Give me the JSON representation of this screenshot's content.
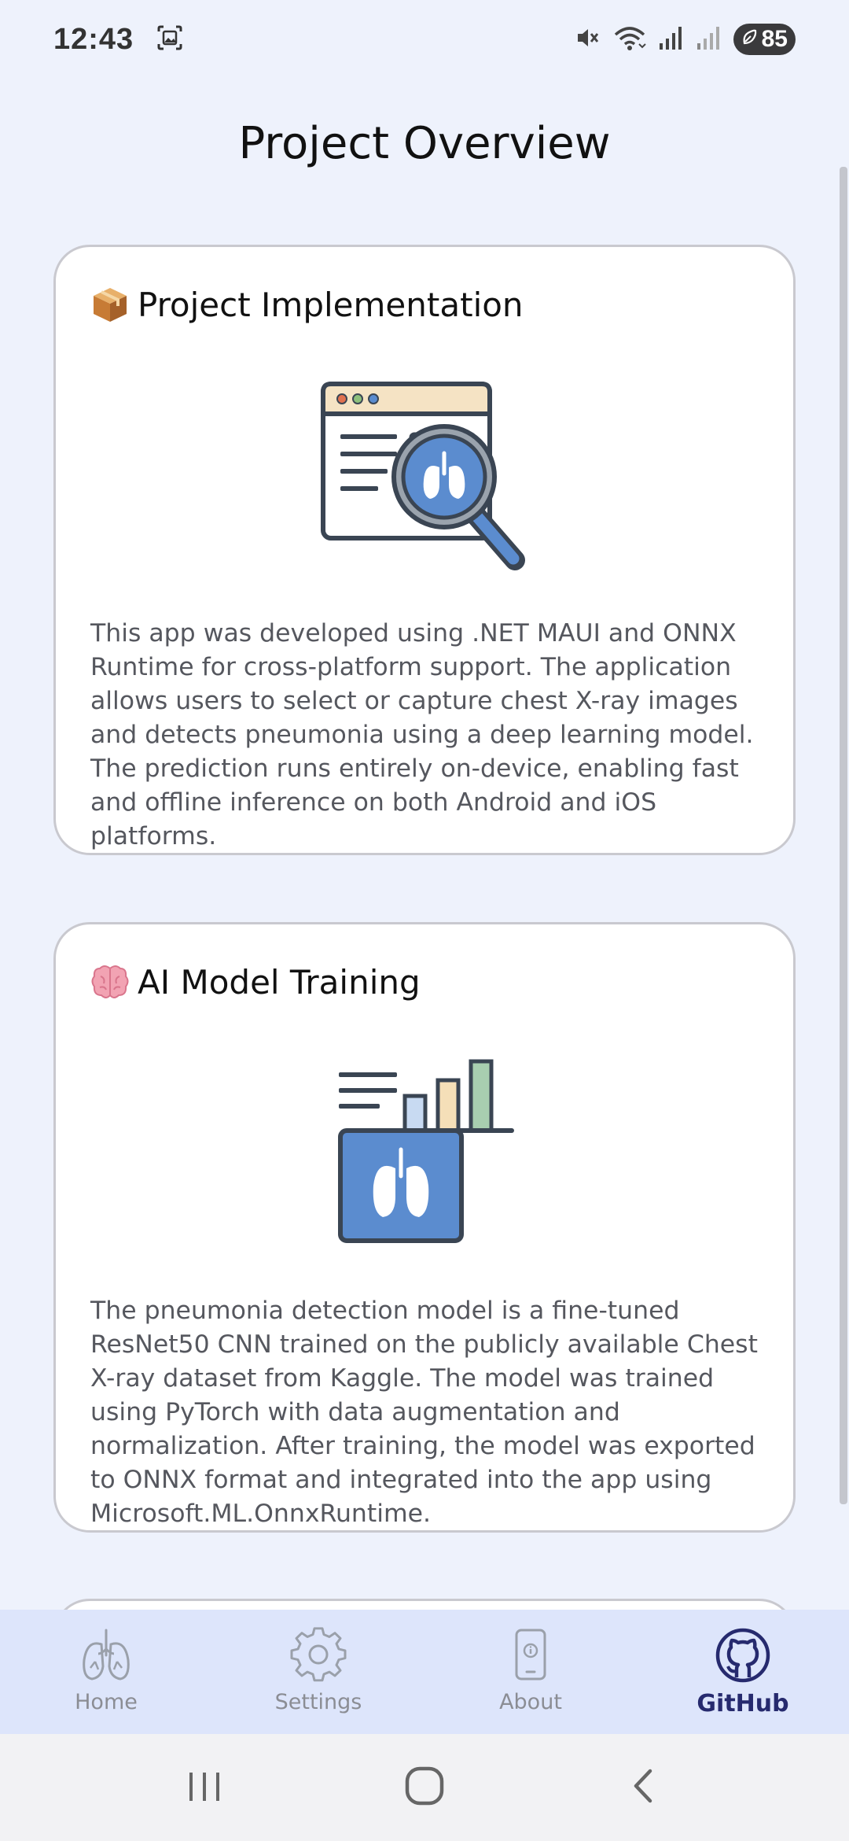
{
  "status_bar": {
    "time": "12:43",
    "battery": "85",
    "icons": [
      "screenshot-icon",
      "mute-icon",
      "wifi-icon",
      "signal-icon",
      "signal-weak-icon",
      "battery-saver-icon"
    ]
  },
  "page": {
    "title": "Project Overview"
  },
  "cards": [
    {
      "emoji_icon": "package-icon",
      "title": "Project Implementation",
      "illustration": "browser-lung-magnifier-illustration",
      "body": "This app was developed using .NET MAUI and ONNX Runtime for cross-platform support. The application allows users to select or capture chest X-ray images and detects pneumonia using a deep learning model. The prediction runs entirely on-device, enabling fast and offline inference on both Android and iOS platforms."
    },
    {
      "emoji_icon": "brain-icon",
      "title": "AI Model Training",
      "illustration": "lung-chart-illustration",
      "body": "The pneumonia detection model is a fine-tuned ResNet50 CNN trained on the publicly available Chest X-ray dataset from Kaggle. The model was trained using PyTorch with data augmentation and normalization. After training, the model was exported to ONNX format and integrated into the app using Microsoft.ML.OnnxRuntime."
    }
  ],
  "bottom_nav": {
    "items": [
      {
        "label": "Home",
        "icon": "lungs-icon",
        "active": false
      },
      {
        "label": "Settings",
        "icon": "gear-icon",
        "active": false
      },
      {
        "label": "About",
        "icon": "phone-info-icon",
        "active": false
      },
      {
        "label": "GitHub",
        "icon": "github-icon",
        "active": true
      }
    ]
  },
  "system_nav": {
    "buttons": [
      "recents-icon",
      "home-icon",
      "back-icon"
    ]
  },
  "colors": {
    "background": "#eef2fc",
    "nav_background": "#dde5fb",
    "active_nav": "#262a6e",
    "inactive_nav": "#8b8d94",
    "body_text": "#55575e",
    "illustration_blue": "#5b8ccf",
    "illustration_dark": "#3a4553"
  }
}
